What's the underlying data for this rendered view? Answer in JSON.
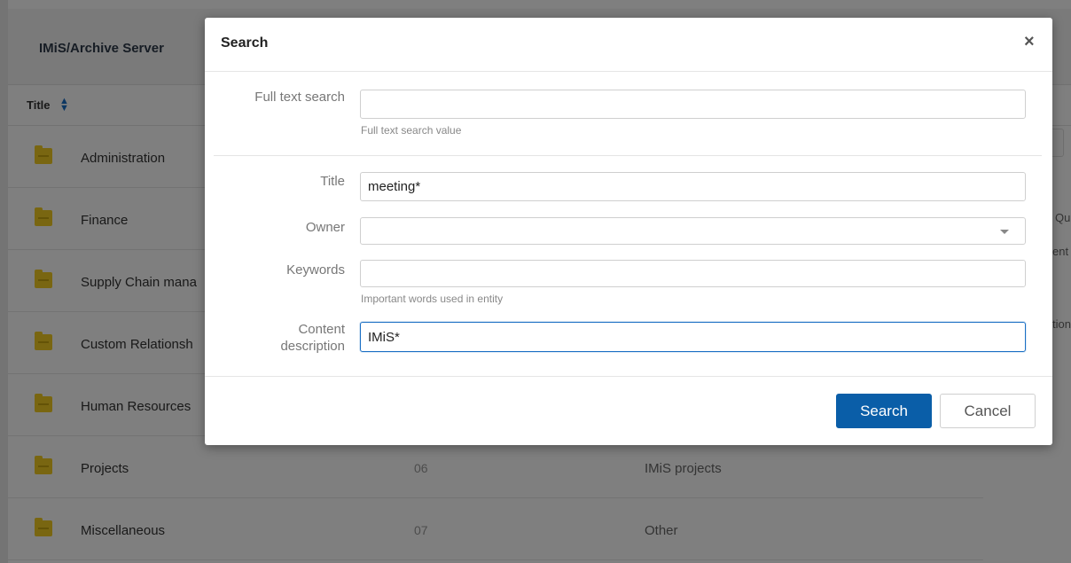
{
  "app": {
    "title": "IMiS/Archive Server",
    "column_title": "Title",
    "rows": [
      {
        "title": "Administration",
        "code": "",
        "description": ""
      },
      {
        "title": "Finance",
        "code": "",
        "description": ""
      },
      {
        "title": "Supply Chain mana",
        "code": "",
        "description": ""
      },
      {
        "title": "Custom Relationsh",
        "code": "",
        "description": ""
      },
      {
        "title": "Human Resources",
        "code": "",
        "description": ""
      },
      {
        "title": "Projects",
        "code": "06",
        "description": "IMiS projects"
      },
      {
        "title": "Miscellaneous",
        "code": "07",
        "description": "Other"
      }
    ],
    "right_fragments": [
      "Qu",
      "ent",
      "tion"
    ]
  },
  "dialog": {
    "title": "Search",
    "close_icon": "×",
    "full_text": {
      "label": "Full text search",
      "value": "",
      "help": "Full text search value"
    },
    "title_field": {
      "label": "Title",
      "value": "meeting*"
    },
    "owner": {
      "label": "Owner",
      "value": ""
    },
    "keywords": {
      "label": "Keywords",
      "value": "",
      "help": "Important words used in entity"
    },
    "content_description": {
      "label_line1": "Content",
      "label_line2": "description",
      "value": "IMiS*"
    },
    "search_button": "Search",
    "cancel_button": "Cancel"
  },
  "colors": {
    "primary": "#0a5ea8",
    "folder": "#f2cd22",
    "focus_border": "#1a6fc4"
  }
}
